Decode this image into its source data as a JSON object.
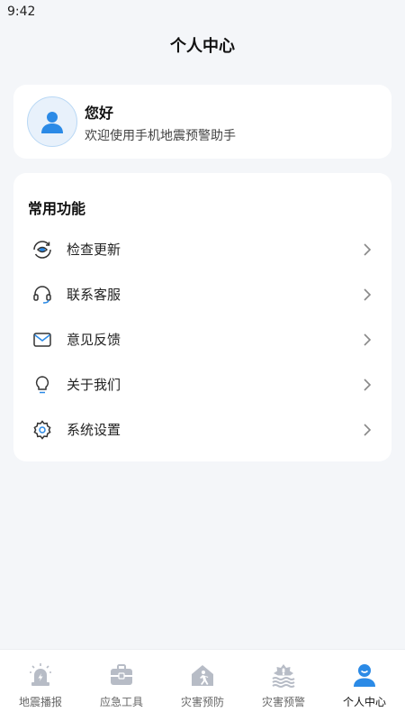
{
  "status_bar": {
    "time": "9:42"
  },
  "header": {
    "title": "个人中心"
  },
  "profile": {
    "greeting": "您好",
    "welcome": "欢迎使用手机地震预警助手",
    "icon": "user-avatar-icon"
  },
  "functions": {
    "title": "常用功能",
    "items": [
      {
        "label": "检查更新",
        "icon": "refresh-eye-icon"
      },
      {
        "label": "联系客服",
        "icon": "headset-icon"
      },
      {
        "label": "意见反馈",
        "icon": "mail-icon"
      },
      {
        "label": "关于我们",
        "icon": "lightbulb-icon"
      },
      {
        "label": "系统设置",
        "icon": "settings-icon"
      }
    ]
  },
  "tabbar": {
    "tabs": [
      {
        "label": "地震播报",
        "icon": "alarm-light-icon",
        "active": false
      },
      {
        "label": "应急工具",
        "icon": "toolbox-icon",
        "active": false
      },
      {
        "label": "灾害预防",
        "icon": "house-escape-icon",
        "active": false
      },
      {
        "label": "灾害预警",
        "icon": "flood-warning-icon",
        "active": false
      },
      {
        "label": "个人中心",
        "icon": "user-icon",
        "active": true
      }
    ]
  },
  "colors": {
    "accent": "#2b8ae6",
    "background": "#f4f6f9",
    "inactive_icon": "#b7bcc6"
  }
}
